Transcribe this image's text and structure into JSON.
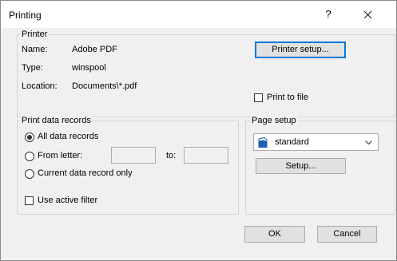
{
  "window": {
    "title": "Printing",
    "help_glyph": "?",
    "close_glyph": "✕"
  },
  "printer": {
    "legend": "Printer",
    "name_label": "Name:",
    "name_value": "Adobe PDF",
    "type_label": "Type:",
    "type_value": "winspool",
    "location_label": "Location:",
    "location_value": "Documents\\*.pdf",
    "setup_button": "Printer setup...",
    "print_to_file": "Print to file",
    "print_to_file_checked": false
  },
  "records": {
    "legend": "Print data records",
    "all": "All data records",
    "from_letter": "From letter:",
    "to": "to:",
    "from_value": "",
    "to_value": "",
    "current_only": "Current data record only",
    "selected": "All data records",
    "use_active_filter": "Use active filter",
    "use_active_filter_checked": false
  },
  "page_setup": {
    "legend": "Page setup",
    "selected": "standard",
    "icon": "page-icon",
    "setup_button": "Setup..."
  },
  "buttons": {
    "ok": "OK",
    "cancel": "Cancel"
  }
}
